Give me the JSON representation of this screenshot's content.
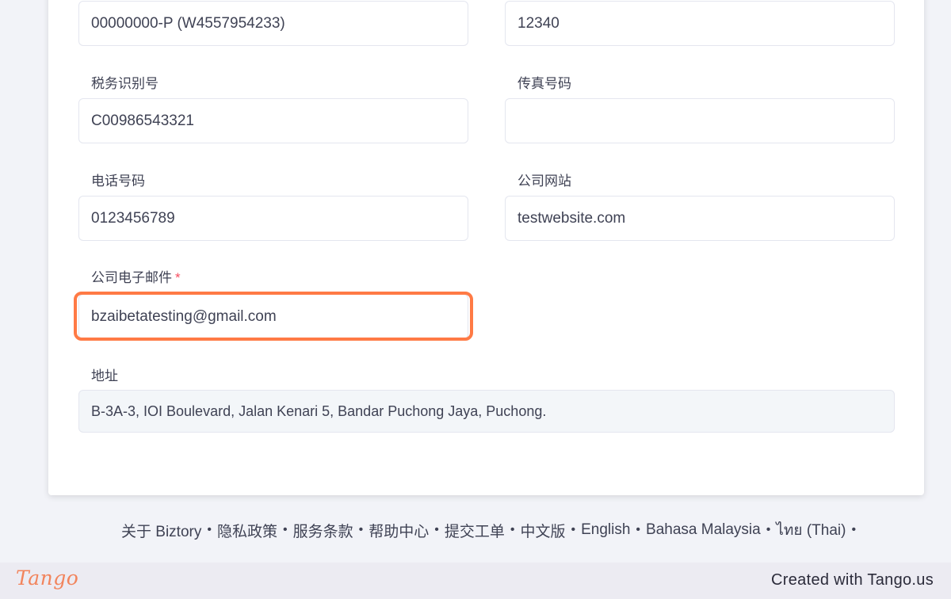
{
  "form": {
    "registration_number_value": "00000000-P (W4557954233)",
    "postcode_value": "12340",
    "tax_id_label": "税务识别号",
    "tax_id_value": "C00986543321",
    "fax_label": "传真号码",
    "fax_value": "",
    "phone_label": "电话号码",
    "phone_value": "0123456789",
    "website_label": "公司网站",
    "website_value": "testwebsite.com",
    "email_label": "公司电子邮件",
    "email_required_mark": "*",
    "email_value": "bzaibetatesting@gmail.com",
    "address_label": "地址",
    "address_value": "B-3A-3, IOI Boulevard, Jalan Kenari 5, Bandar Puchong Jaya, Puchong."
  },
  "footer": {
    "links": [
      "关于 Biztory",
      "隐私政策",
      "服务条款",
      "帮助中心",
      "提交工单",
      "中文版",
      "English",
      "Bahasa Malaysia",
      "ไทย (Thai)"
    ],
    "separator": "•"
  },
  "tango": {
    "logo": "Tango",
    "created_with": "Created with Tango.us"
  },
  "colors": {
    "highlight": "#ff7a45",
    "required": "#f64e60",
    "tango_logo": "#f2845c"
  }
}
